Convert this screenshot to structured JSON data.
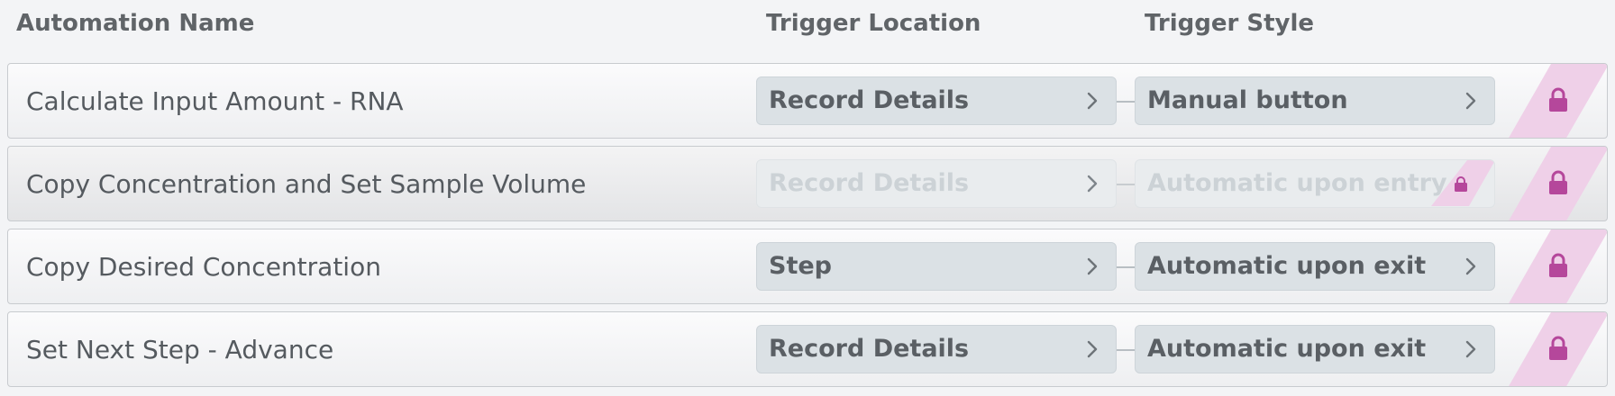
{
  "header": {
    "automation_name": "Automation Name",
    "trigger_location": "Trigger Location",
    "trigger_style": "Trigger Style"
  },
  "rows": [
    {
      "name": "Calculate Input Amount - RNA",
      "location": "Record Details",
      "style": "Manual button",
      "disabled": false,
      "locked": true
    },
    {
      "name": "Copy Concentration and Set Sample Volume",
      "location": "Record Details",
      "style": "Automatic upon entry",
      "disabled": true,
      "locked": true
    },
    {
      "name": "Copy Desired Concentration",
      "location": "Step",
      "style": "Automatic upon exit",
      "disabled": false,
      "locked": true
    },
    {
      "name": "Set Next Step - Advance",
      "location": "Record Details",
      "style": "Automatic upon exit",
      "disabled": false,
      "locked": true
    }
  ],
  "icons": {
    "chevron": "chevron-right-icon",
    "lock": "lock-icon"
  },
  "colors": {
    "lock_accent": "#b5479b",
    "lock_stripe": "#efd0e8",
    "pill_bg": "#dbe1e5"
  }
}
